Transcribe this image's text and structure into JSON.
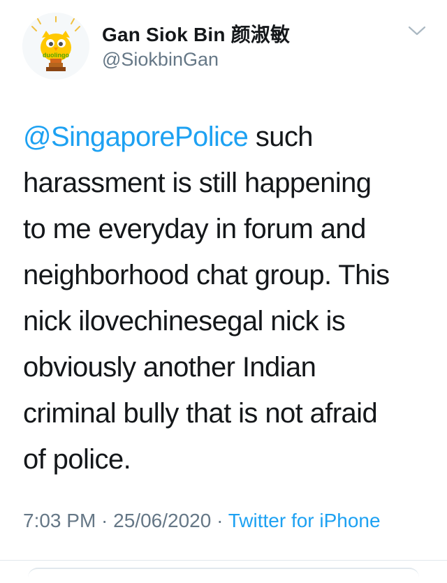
{
  "tweet": {
    "author": {
      "display_name": "Gan Siok Bin 颜淑敏",
      "handle": "@SiokbinGan",
      "avatar_badge_text": "duolingo"
    },
    "text": {
      "mention": "@SingaporePolice",
      "line1_rest": " such",
      "lines": [
        "harassment is still happening",
        "to me everyday in forum and",
        "neighborhood chat group. This",
        "nick ilovechinesegal nick is",
        "obviously another Indian",
        "criminal bully that is not afraid",
        "of police."
      ]
    },
    "meta": {
      "time": "7:03 PM",
      "separator": " · ",
      "date": "25/06/2020",
      "source": "Twitter for iPhone"
    }
  },
  "colors": {
    "link": "#1da1f2",
    "secondary": "#657786",
    "text": "#14171a",
    "divider": "#e1e8ed"
  },
  "icons": {
    "options": "chevron-down-icon",
    "avatar": "duolingo-owl-icon"
  }
}
